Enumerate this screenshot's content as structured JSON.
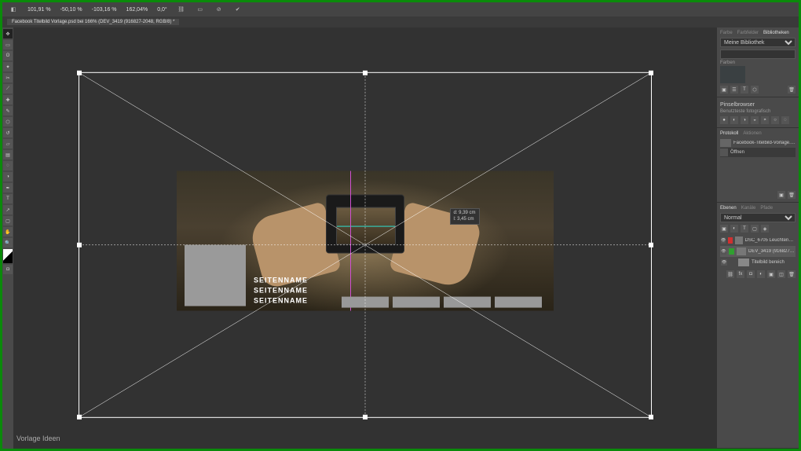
{
  "top_bar": {
    "zoom": "101,91 %",
    "x": "-50,10 %",
    "y": "-103,16 %",
    "w": "162,04%",
    "h": "0,0°"
  },
  "doc_tab": "Facebook Titelbild Vorlage.psd bei 166% (DEV_3419 (916827-2048, RGB/8) *",
  "measure": {
    "w": "d: 9,39 cm",
    "h": "l: 3,45 cm"
  },
  "cover": {
    "text1": "SEITENNAME",
    "text2": "SEITENNAME",
    "text3": "SEITENNAME"
  },
  "right": {
    "tabs1": [
      "Farbe",
      "Farbfelder",
      "Bibliotheken"
    ],
    "library_select": "Meine Bibliothek",
    "search_ph": "",
    "section_farben": "Farben",
    "brush_title": "Pinselbrowser",
    "brush_sub": "Benutzteste fotografisch",
    "proto_tabs": [
      "Protokoll",
      "Aktionen"
    ],
    "proto_file": "Facebook-Titelbild-Vorlage.psd",
    "proto_action": "Öffnen",
    "layers_tabs": [
      "Ebenen",
      "Kanäle",
      "Pfade"
    ],
    "layers_kind": "Normal",
    "layers": [
      {
        "chip": "#d03030",
        "name": "DSC_6705 Leuchtender-un Paar..."
      },
      {
        "chip": "#30a030",
        "name": "DEV_3419 (916827-2048"
      },
      {
        "chip": "",
        "name": "Titelbild bereich"
      }
    ]
  },
  "watermark": "Vorlage Ideen"
}
